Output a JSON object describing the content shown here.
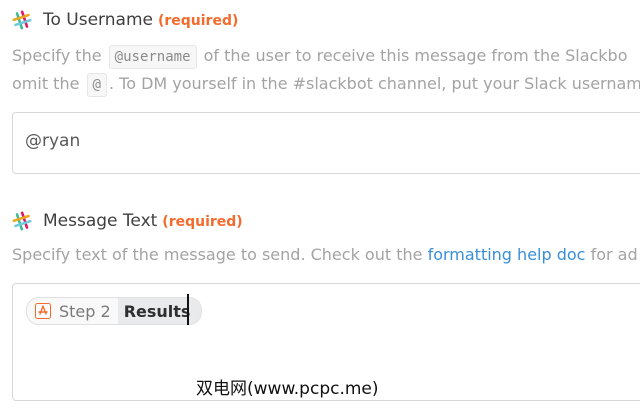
{
  "field_username": {
    "label": "To Username",
    "required": "(required)",
    "icon": "slack-icon",
    "help_line1_pre": "Specify the",
    "help_line1_code": "@username",
    "help_line1_post": "of the user to receive this message from the Slackbo",
    "help_line2_pre": "omit the",
    "help_line2_code": "@",
    "help_line2_post": ". To DM yourself in the #slackbot channel, put your Slack usernam",
    "value": "@ryan"
  },
  "field_message": {
    "label": "Message Text",
    "required": "(required)",
    "icon": "slack-icon",
    "help_pre": "Specify text of the message to send. Check out the",
    "help_link": "formatting help doc",
    "help_post": "for ad",
    "pill": {
      "app_icon": "app-trigger-icon",
      "step": "Step 2",
      "field": "Results"
    }
  },
  "watermark": "双电网(www.pcpc.me)",
  "colors": {
    "required": "#f46c2d",
    "link": "#3a8fd8",
    "help_text": "#a3a3a3",
    "border": "#d8d8d8"
  }
}
